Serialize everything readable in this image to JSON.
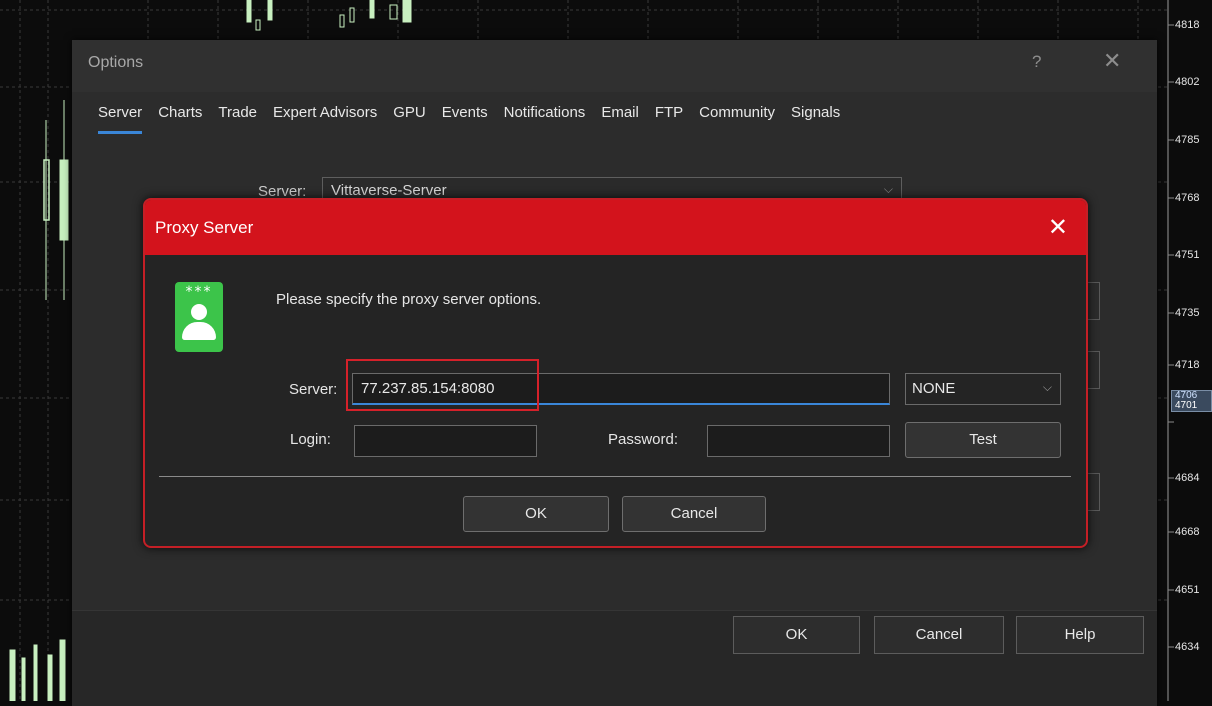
{
  "chart": {
    "price_labels": [
      "4818",
      "4802",
      "4785",
      "4768",
      "4751",
      "4735",
      "4718",
      "4701",
      "4684",
      "4668",
      "4651",
      "4634"
    ],
    "current_price": [
      "4706",
      "4701"
    ]
  },
  "options": {
    "title": "Options",
    "help_label": "?",
    "close_label": "✕",
    "tabs": [
      {
        "label": "Server",
        "active": true
      },
      {
        "label": "Charts"
      },
      {
        "label": "Trade"
      },
      {
        "label": "Expert Advisors"
      },
      {
        "label": "GPU"
      },
      {
        "label": "Events"
      },
      {
        "label": "Notifications"
      },
      {
        "label": "Email"
      },
      {
        "label": "FTP"
      },
      {
        "label": "Community"
      },
      {
        "label": "Signals"
      }
    ],
    "server_label": "Server:",
    "server_value": "Vittaverse-Server",
    "footer": {
      "ok": "OK",
      "cancel": "Cancel",
      "help": "Help"
    }
  },
  "proxy": {
    "title": "Proxy Server",
    "close_label": "✕",
    "icon_stars": "***",
    "message": "Please specify the proxy server options.",
    "server_label": "Server:",
    "server_value": "77.237.85.154:8080",
    "type_value": "NONE",
    "login_label": "Login:",
    "login_value": "",
    "password_label": "Password:",
    "password_value": "",
    "test_label": "Test",
    "ok_label": "OK",
    "cancel_label": "Cancel"
  },
  "colors": {
    "accent_blue": "#3a86d8",
    "proxy_red": "#d3131c",
    "icon_green": "#3cc44a",
    "candle_green": "#c8f0c0"
  }
}
